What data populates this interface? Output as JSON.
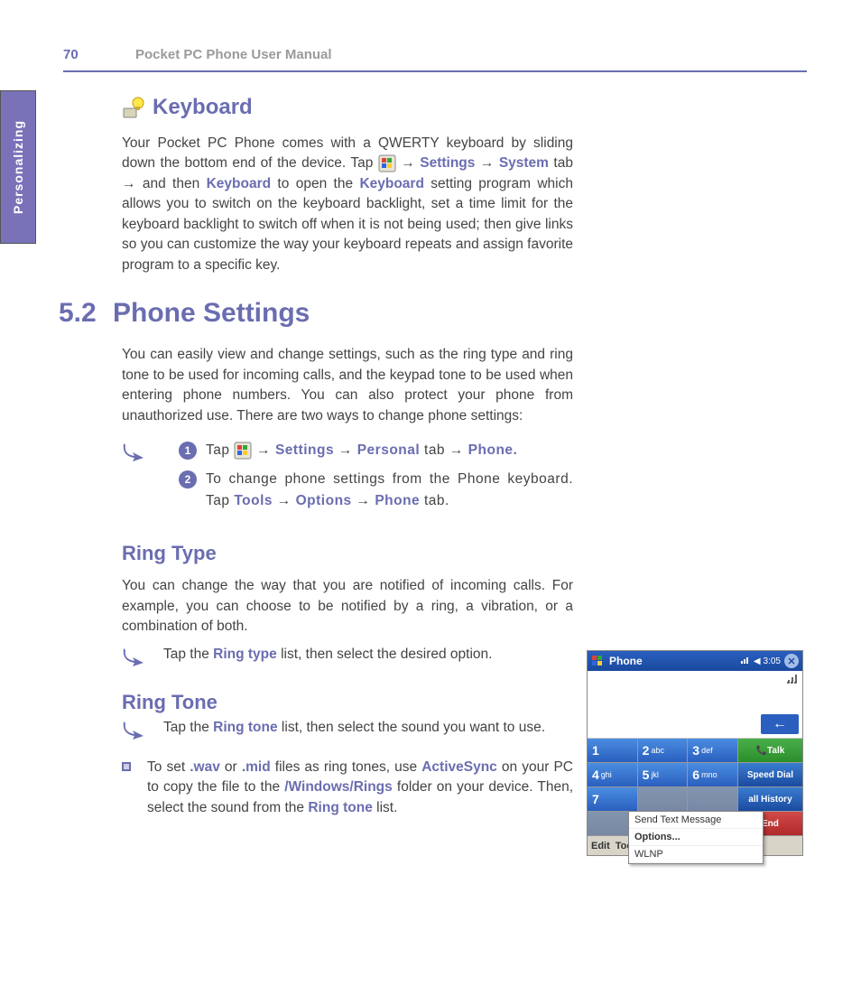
{
  "header": {
    "page_number": "70",
    "title": "Pocket PC Phone User Manual"
  },
  "side_tab": "Personalizing",
  "keyboard": {
    "heading": "Keyboard",
    "para_parts": {
      "p1": "Your Pocket PC Phone comes with a QWERTY keyboard by sliding down the bottom end of the device. Tap ",
      "arrow1": " → ",
      "settings": "Settings",
      "arrow2": " → ",
      "system": "System",
      "p2": " tab → and then ",
      "kbd1": "Keyboard",
      "p3": " to open the ",
      "kbd2": "Keyboard",
      "p4": " setting program which allows you to switch on the keyboard backlight, set a time limit for the keyboard backlight to switch off when it is not being used; then give links so you can customize the way your keyboard repeats and assign favorite program to a specific key."
    }
  },
  "phone_settings": {
    "num": "5.2",
    "heading": "Phone Settings",
    "intro": "You can easily view and change settings, such as the ring type and ring tone to be used for incoming calls, and the keypad tone to be used when entering phone numbers. You can also protect your phone from unauthorized use. There are two ways to change phone settings:",
    "steps": {
      "s1": {
        "badge": "1",
        "pre": "Tap ",
        "arrow1": " → ",
        "settings": "Settings",
        "arrow2": " → ",
        "personal": "Personal",
        "mid": " tab → ",
        "phone": "Phone",
        "dot": "."
      },
      "s2": {
        "badge": "2",
        "pre": "To change phone settings from the Phone keyboard. Tap ",
        "tools": "Tools",
        "arrow1": " → ",
        "options": "Options",
        "arrow2": " → ",
        "phone": "Phone",
        "post": " tab."
      }
    }
  },
  "ring_type": {
    "heading": "Ring Type",
    "para": "You can change the way that you are notified of incoming calls. For example, you can choose to be notified by a ring, a vibration, or a combination of both.",
    "tip_pre": "Tap the ",
    "tip_term": "Ring type",
    "tip_post": " list, then select the desired option."
  },
  "ring_tone": {
    "heading": "Ring Tone",
    "tip_pre": "Tap the ",
    "tip_term": "Ring tone",
    "tip_post": " list, then select the sound you want to use.",
    "bullet": {
      "pre": "To set ",
      "wav": ".wav",
      "or": " or ",
      "mid": ".mid",
      "p1": " files as ring tones, use ",
      "as": "ActiveSync",
      "p2": " on your PC to copy the file to the ",
      "folder": "/Windows/Rings",
      "p3": " folder on your device. Then, select the sound from the ",
      "rt": "Ring tone",
      "p4": " list."
    }
  },
  "phone_mock": {
    "title": "Phone",
    "time": "3:05",
    "keys": {
      "1": "1",
      "2n": "2",
      "2l": "abc",
      "3n": "3",
      "3l": "def",
      "4n": "4",
      "4l": "ghi",
      "5n": "5",
      "5l": "jkl",
      "6n": "6",
      "6l": "mno",
      "7n": "7"
    },
    "fn": {
      "talk": "Talk",
      "speed": "Speed Dial",
      "hist": "all History",
      "end": "End"
    },
    "popup": {
      "i1": "Send Text Message",
      "i2": "Options...",
      "i3": "WLNP"
    },
    "bottom": {
      "edit": "Edit",
      "tools": "Tools"
    }
  }
}
